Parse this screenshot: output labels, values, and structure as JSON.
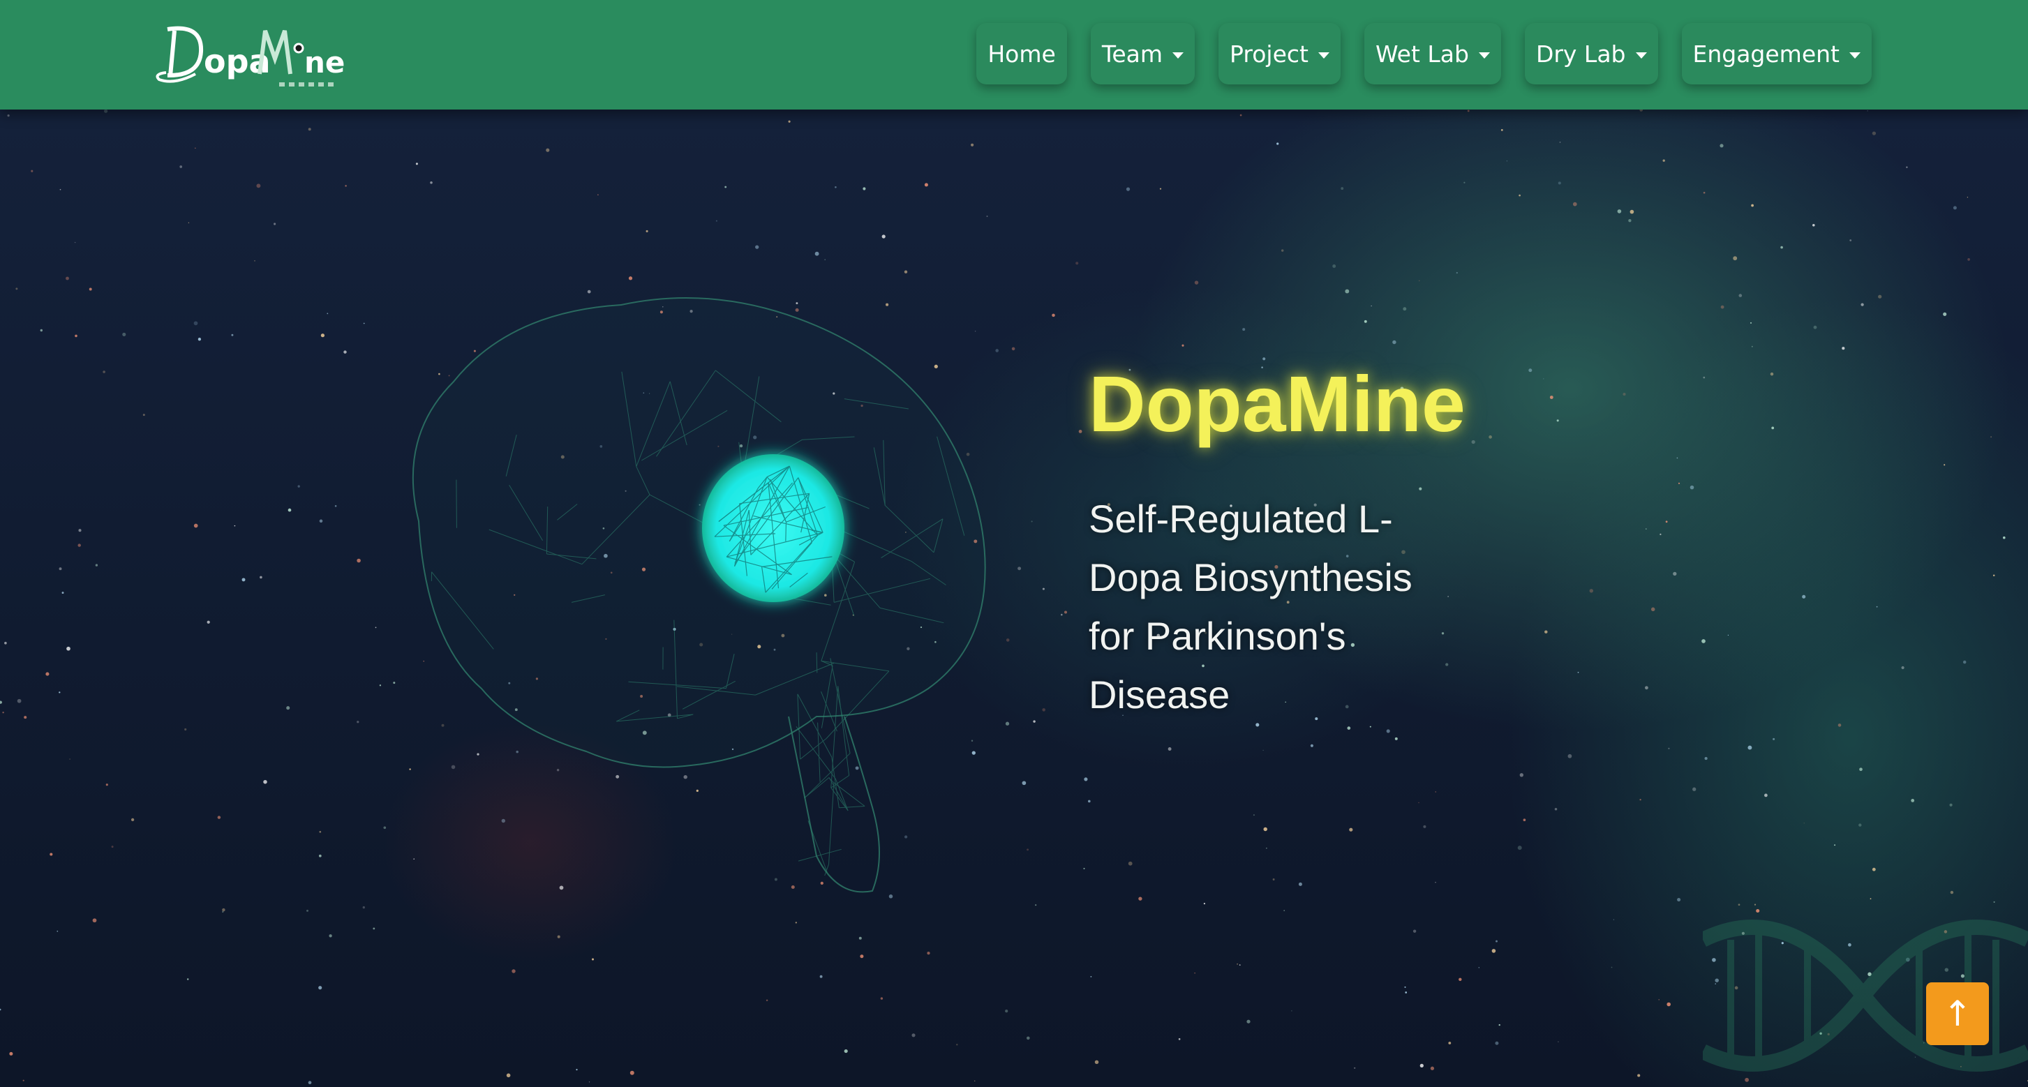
{
  "brand": {
    "logo_text": "DopaMine"
  },
  "nav": {
    "items": [
      {
        "label": "Home",
        "dropdown": false
      },
      {
        "label": "Team",
        "dropdown": true
      },
      {
        "label": "Project",
        "dropdown": true
      },
      {
        "label": "Wet Lab",
        "dropdown": true
      },
      {
        "label": "Dry Lab",
        "dropdown": true
      },
      {
        "label": "Engagement",
        "dropdown": true
      }
    ]
  },
  "hero": {
    "title": "DopaMine",
    "subtitle": "Self-Regulated L-Dopa Biosynthesis for Parkinson's Disease"
  },
  "scroll_top": {
    "icon": "arrow-up-icon",
    "glyph": "↑"
  },
  "colors": {
    "navbar": "#2a8c5e",
    "title": "#f4f15a",
    "accent_orb": "#22f0ee",
    "scroll_button": "#f39a1c"
  }
}
